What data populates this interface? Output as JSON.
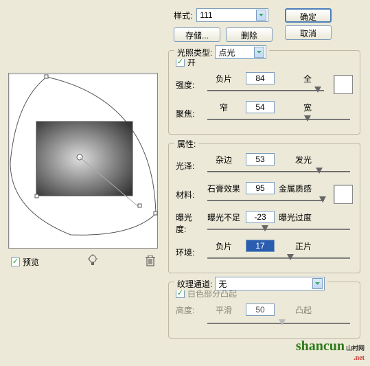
{
  "top": {
    "style_label": "样式:",
    "style_value": "111",
    "save_btn": "存储...",
    "delete_btn": "删除",
    "ok_btn": "确定",
    "cancel_btn": "取消"
  },
  "light": {
    "type_label": "光照类型:",
    "type_value": "点光",
    "on_label": "开",
    "rows": [
      {
        "label": "强度:",
        "left": "负片",
        "value": "84",
        "right": "全",
        "pos": 92,
        "swatch": true
      },
      {
        "label": "聚焦:",
        "left": "窄",
        "value": "54",
        "right": "宽",
        "pos": 68,
        "swatch": false
      }
    ]
  },
  "props": {
    "legend": "属性:",
    "rows": [
      {
        "label": "光泽:",
        "left": "杂边",
        "value": "53",
        "right": "发光",
        "pos": 76,
        "swatch": false
      },
      {
        "label": "材料:",
        "left": "石膏效果",
        "value": "95",
        "right": "金属质感",
        "pos": 96,
        "swatch": true
      },
      {
        "label": "曝光度:",
        "left": "曝光不足",
        "value": "-23",
        "right": "曝光过度",
        "pos": 38,
        "swatch": false
      },
      {
        "label": "环境:",
        "left": "负片",
        "value": "17",
        "right": "正片",
        "pos": 56,
        "swatch": false,
        "selected": true
      }
    ]
  },
  "texture": {
    "channel_label": "纹理通道:",
    "channel_value": "无",
    "white_label": "白色部分凸起",
    "height_label": "高度:",
    "left": "平滑",
    "value": "50",
    "right": "凸起",
    "pos": 50
  },
  "preview": {
    "checkbox_label": "预览"
  },
  "watermark": {
    "text": "shancun",
    "suffix": ".net",
    "cn": "山村网"
  }
}
